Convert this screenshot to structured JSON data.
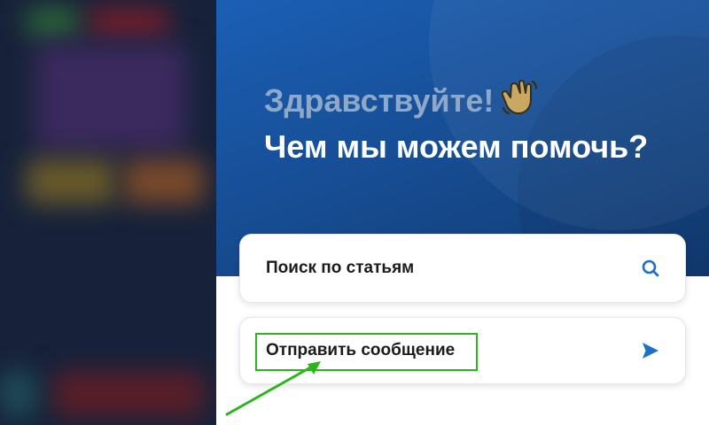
{
  "widget": {
    "greeting_line1": "Здравствуйте!",
    "greeting_line2": "Чем мы можем помочь?",
    "wave_icon": "waving-hand-icon",
    "header_color": "#1b5fb5",
    "cards": {
      "search": {
        "label": "Поиск по статьям",
        "icon": "search-icon"
      },
      "message": {
        "label": "Отправить сообщение",
        "icon": "send-icon"
      }
    }
  },
  "annotation": {
    "highlight_color": "#2bb51d"
  }
}
